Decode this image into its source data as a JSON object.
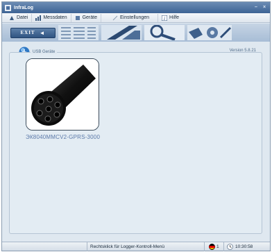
{
  "window": {
    "title": "InfraLog"
  },
  "menu": {
    "items": [
      {
        "label": "Datei",
        "icon": "file-icon"
      },
      {
        "label": "Messdaten",
        "icon": "chart-icon"
      },
      {
        "label": "Geräte",
        "icon": "device-icon"
      },
      {
        "label": "Einstellungen",
        "icon": "settings-icon"
      },
      {
        "label": "Hilfe",
        "icon": "help-icon"
      }
    ]
  },
  "toolbar": {
    "exit_label": "EXIT"
  },
  "main": {
    "group_label": "USB Geräte",
    "version": "Version 5.8.21",
    "device": {
      "name": "ЭК8040MMCV2-GPRS-3000"
    }
  },
  "status": {
    "hint": "Rechtsklick für Logger-Kontroll-Menü",
    "lang_number": "1",
    "time": "10:30:58"
  },
  "colors": {
    "titlebar": "#3d6394",
    "accent": "#5a78a8"
  }
}
